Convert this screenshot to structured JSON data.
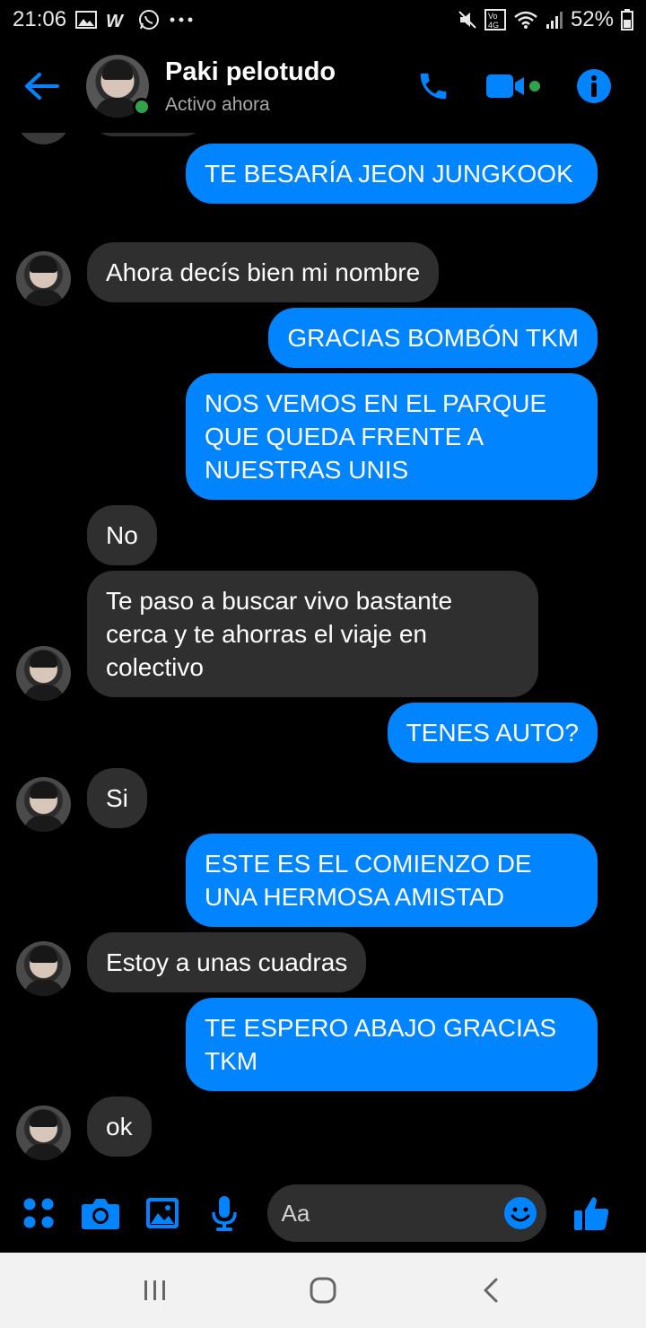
{
  "status_bar": {
    "time": "21:06",
    "battery": "52%",
    "icons_left": [
      "gallery-icon",
      "w-app-icon",
      "whatsapp-icon",
      "more-icon"
    ],
    "icons_right": [
      "mute-icon",
      "volte-icon",
      "wifi-icon",
      "signal-icon",
      "battery-icon"
    ]
  },
  "header": {
    "contact_name": "Paki pelotudo",
    "contact_status": "Activo ahora",
    "online": true
  },
  "messages": [
    {
      "side": "out",
      "text": "TE BESARÍA JEON JUNGKOOK"
    },
    {
      "side": "in",
      "text": "Ahora decís bien mi nombre",
      "avatar": true
    },
    {
      "side": "out",
      "text": "GRACIAS BOMBÓN TKM"
    },
    {
      "side": "out",
      "text": "NOS VEMOS EN EL PARQUE QUE QUEDA FRENTE A NUESTRAS UNIS"
    },
    {
      "side": "in",
      "text": "No",
      "avatar": false
    },
    {
      "side": "in",
      "text": "Te paso a buscar vivo bastante cerca y te ahorras el viaje en colectivo",
      "avatar": true
    },
    {
      "side": "out",
      "text": "TENES AUTO?"
    },
    {
      "side": "in",
      "text": "Si",
      "avatar": true
    },
    {
      "side": "out",
      "text": "ESTE ES EL COMIENZO DE UNA HERMOSA AMISTAD"
    },
    {
      "side": "in",
      "text": "Estoy a unas cuadras",
      "avatar": true
    },
    {
      "side": "out",
      "text": "TE ESPERO ABAJO GRACIAS TKM"
    },
    {
      "side": "in",
      "text": "ok",
      "avatar": true
    }
  ],
  "composer": {
    "placeholder": "Aa"
  },
  "colors": {
    "accent": "#0084ff",
    "incoming_bubble": "#2f2f2f",
    "background": "#000000",
    "online": "#31a24c"
  }
}
